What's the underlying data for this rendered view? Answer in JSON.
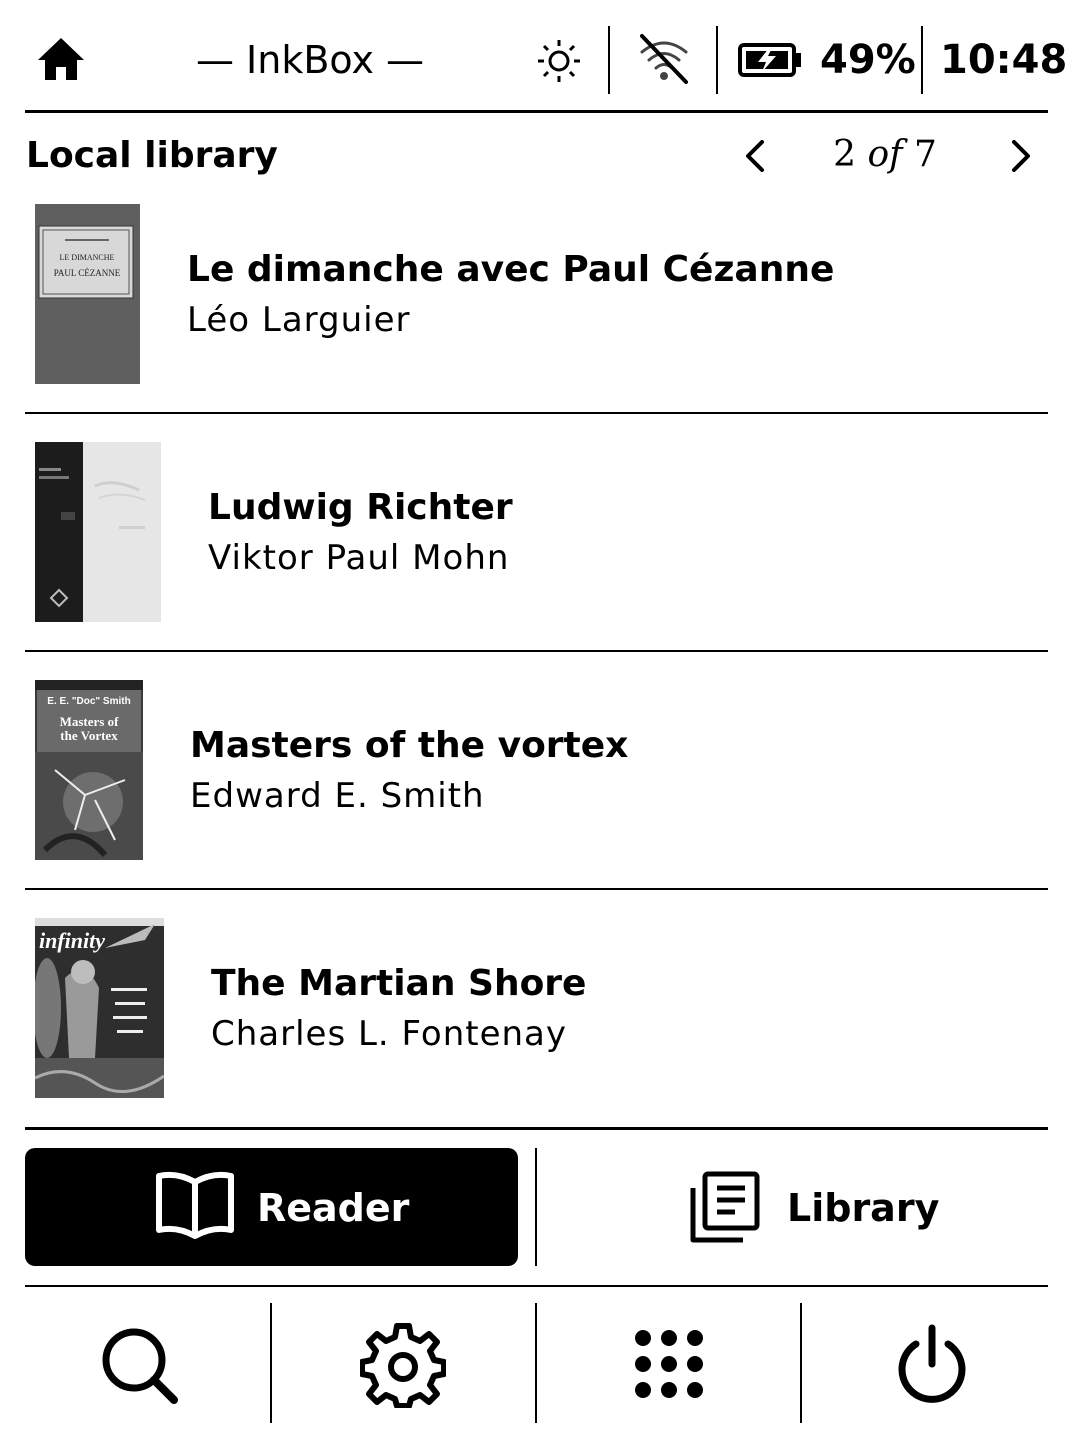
{
  "status_bar": {
    "app_title": "— InkBox —",
    "battery_percent": "49%",
    "time": "10:48",
    "icons": [
      "home-icon",
      "brightness-icon",
      "wifi-off-icon",
      "battery-charging-icon"
    ]
  },
  "library": {
    "heading": "Local library",
    "page_current": "2",
    "page_of": "of",
    "page_total": "7"
  },
  "books": [
    {
      "title": "Le dimanche avec Paul Cézanne",
      "author": "Léo Larguier",
      "cover": {
        "line1": "LE DIMANCHE",
        "line2": "PAUL CÉZANNE"
      }
    },
    {
      "title": "Ludwig Richter",
      "author": "Viktor Paul Mohn"
    },
    {
      "title": "Masters of the vortex",
      "author": "Edward E. Smith",
      "cover": {
        "line1": "E. E. \"Doc\" Smith",
        "line2": "Masters of",
        "line3": "the Vortex"
      }
    },
    {
      "title": "The Martian Shore",
      "author": "Charles L. Fontenay",
      "cover": {
        "line1": "infinity"
      }
    }
  ],
  "tabs": {
    "reader_label": "Reader",
    "library_label": "Library",
    "active": "reader"
  },
  "bottom_nav": [
    "search-icon",
    "settings-icon",
    "apps-icon",
    "power-icon"
  ]
}
